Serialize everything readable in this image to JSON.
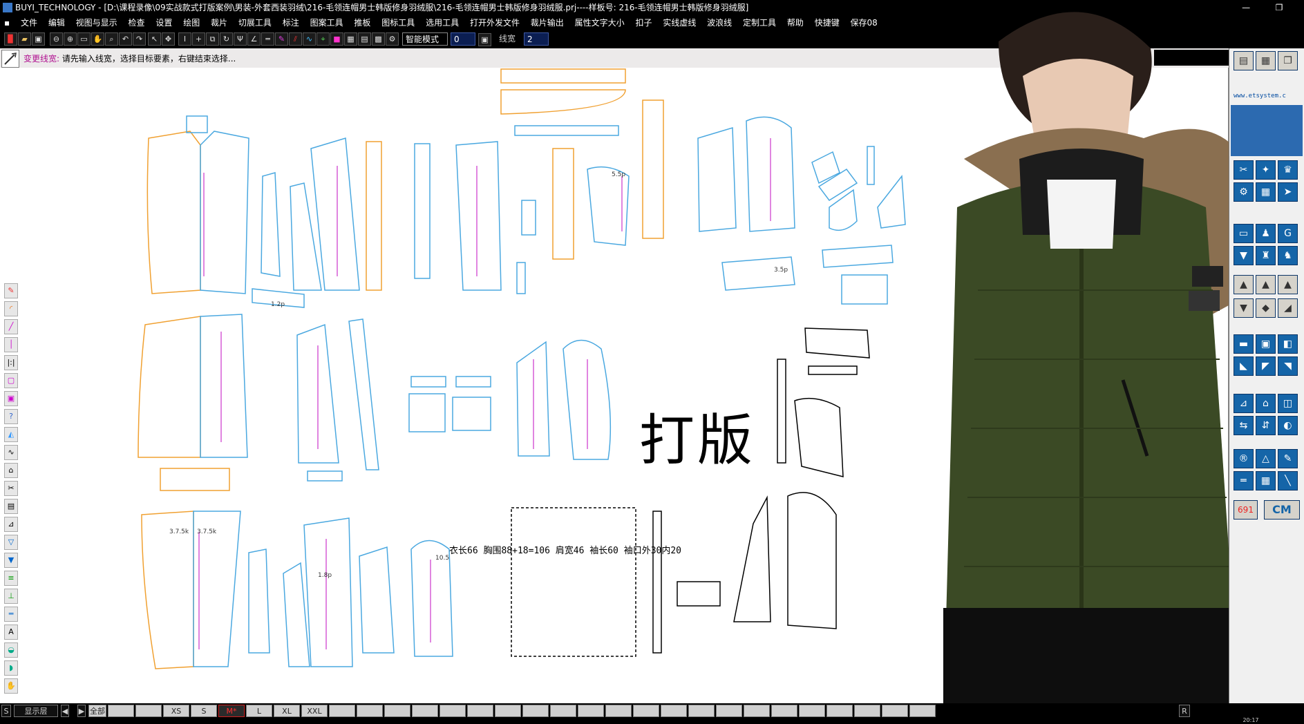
{
  "titlebar": {
    "text": "BUYI_TECHNOLOGY - [D:\\课程录像\\09实战款式打版案例\\男装-外套西装羽绒\\216-毛领连帽男士韩版修身羽绒服\\216-毛领连帽男士韩版修身羽绒服.prj----样板号: 216-毛领连帽男士韩版修身羽绒服]",
    "minimize": "—",
    "restore": "❐"
  },
  "menubar": {
    "items": [
      "文件",
      "编辑",
      "视图与显示",
      "检查",
      "设置",
      "绘图",
      "裁片",
      "切展工具",
      "标注",
      "图案工具",
      "推板",
      "图标工具",
      "选用工具",
      "打开外发文件",
      "裁片输出",
      "属性文字大小",
      "扣子",
      "实线虚线",
      "波浪线",
      "定制工具",
      "帮助",
      "快捷键",
      "保存08"
    ]
  },
  "toolbar": {
    "mode_select": "智能模式F8",
    "value_field": "0",
    "width_label": "线宽",
    "width_value": "2"
  },
  "prompt": {
    "command": "变更线宽:",
    "message": "请先输入线宽，选择目标要素，右键结束选择..."
  },
  "canvas": {
    "watermark": "打版",
    "measurements": "衣长66  胸围88+18=106  肩宽46  袖长60  袖口外30内20",
    "piece_labels": [
      "3.5p",
      "1.2p",
      "3.5p",
      "5.5p",
      "3.7.5k",
      "3.7.5k",
      "1.8p",
      "10.5"
    ]
  },
  "rightpanel": {
    "url": "www.etsystem.c",
    "counter": "691",
    "unit": "CM"
  },
  "statusbar": {
    "s": "S",
    "layer": "显示层",
    "all": "全部",
    "sizes": [
      "XS",
      "S",
      "M*",
      "L",
      "XL",
      "XXL"
    ],
    "r": "R",
    "time": "20:17"
  },
  "colors": {
    "accent_blue": "#1565a8",
    "orange_seam": "#f0a030",
    "blue_seam": "#4aa8e0",
    "grain_line": "#cc33cc",
    "prompt_cmd": "#b01090",
    "jacket": "#3b4a25"
  }
}
